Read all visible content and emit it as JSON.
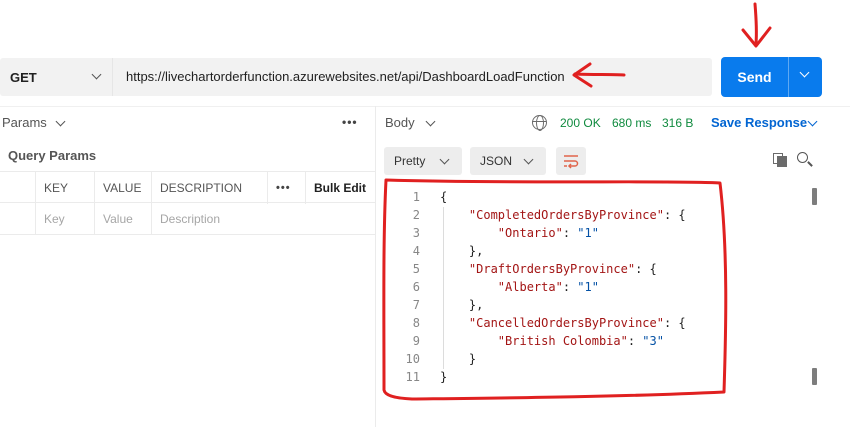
{
  "request": {
    "method": "GET",
    "url": "https://livechartorderfunction.azurewebsites.net/api/DashboardLoadFunction",
    "send_label": "Send"
  },
  "left_pane": {
    "tab_label": "Params",
    "section_title": "Query Params",
    "columns": [
      "KEY",
      "VALUE",
      "DESCRIPTION"
    ],
    "bulk_edit": "Bulk Edit",
    "row_placeholders": {
      "key": "Key",
      "value": "Value",
      "description": "Description"
    }
  },
  "right_pane": {
    "tab_label": "Body",
    "status": "200 OK",
    "time": "680 ms",
    "size": "316 B",
    "save_label": "Save Response",
    "view_mode": "Pretty",
    "format": "JSON"
  },
  "code_lines": [
    {
      "n": "1",
      "indent": "",
      "key": "",
      "value": "",
      "tail": "{"
    },
    {
      "n": "2",
      "indent": "    ",
      "key": "\"CompletedOrdersByProvince\"",
      "value": "",
      "tail": ": {"
    },
    {
      "n": "3",
      "indent": "        ",
      "key": "\"Ontario\"",
      "value": "\"1\"",
      "tail": ": "
    },
    {
      "n": "4",
      "indent": "    ",
      "key": "",
      "value": "",
      "tail": "},"
    },
    {
      "n": "5",
      "indent": "    ",
      "key": "\"DraftOrdersByProvince\"",
      "value": "",
      "tail": ": {"
    },
    {
      "n": "6",
      "indent": "        ",
      "key": "\"Alberta\"",
      "value": "\"1\"",
      "tail": ": "
    },
    {
      "n": "7",
      "indent": "    ",
      "key": "",
      "value": "",
      "tail": "},"
    },
    {
      "n": "8",
      "indent": "    ",
      "key": "\"CancelledOrdersByProvince\"",
      "value": "",
      "tail": ": {"
    },
    {
      "n": "9",
      "indent": "        ",
      "key": "\"British Colombia\"",
      "value": "\"3\"",
      "tail": ": "
    },
    {
      "n": "10",
      "indent": "    ",
      "key": "",
      "value": "",
      "tail": "}"
    },
    {
      "n": "11",
      "indent": "",
      "key": "",
      "value": "",
      "tail": "}"
    }
  ],
  "colors": {
    "send_button": "#097bed",
    "status_ok": "#0f8a3e",
    "annotation_red": "#e02020"
  }
}
